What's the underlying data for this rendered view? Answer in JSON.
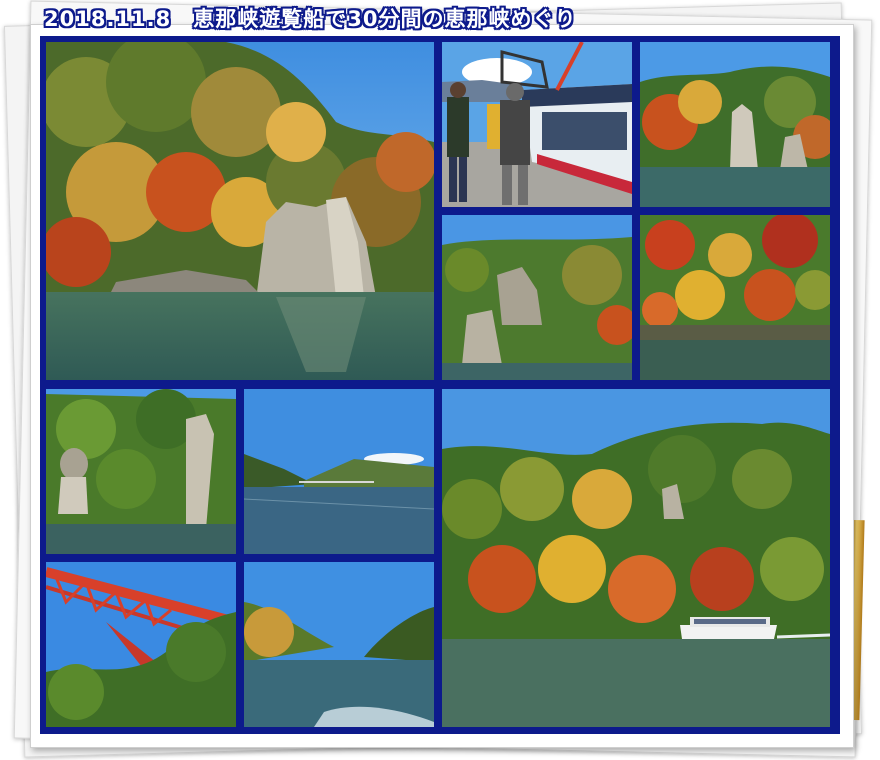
{
  "title": "2018.11.8　恵那峡遊覧船で30分間の恵那峡めぐり",
  "photos": [
    {
      "name": "photo-large-cliff",
      "subject": "autumn cliff with rock formations over reservoir"
    },
    {
      "name": "photo-boarding",
      "subject": "passengers boarding sightseeing boat"
    },
    {
      "name": "photo-rock-pillars",
      "subject": "rock pillars on forested shore"
    },
    {
      "name": "photo-shore-rocks",
      "subject": "rocky shoreline with green forest"
    },
    {
      "name": "photo-red-foliage",
      "subject": "red and yellow autumn foliage on slope"
    },
    {
      "name": "photo-stone-towers",
      "subject": "stacked stone towers by water"
    },
    {
      "name": "photo-distant-bridge",
      "subject": "calm water view toward distant bridge"
    },
    {
      "name": "photo-boat-on-lake",
      "subject": "sightseeing boat passing autumn mountainside"
    },
    {
      "name": "photo-red-bridge",
      "subject": "red steel arch bridge above forest"
    },
    {
      "name": "photo-valley-wake",
      "subject": "valley view with boat wake"
    }
  ],
  "colors": {
    "frame": "#0d1a8c",
    "sky": "#4f9be0",
    "water": "#3f6f6a",
    "foliage_red": "#c8401e",
    "foliage_yellow": "#d8a23a",
    "forest": "#3f6e2a"
  }
}
